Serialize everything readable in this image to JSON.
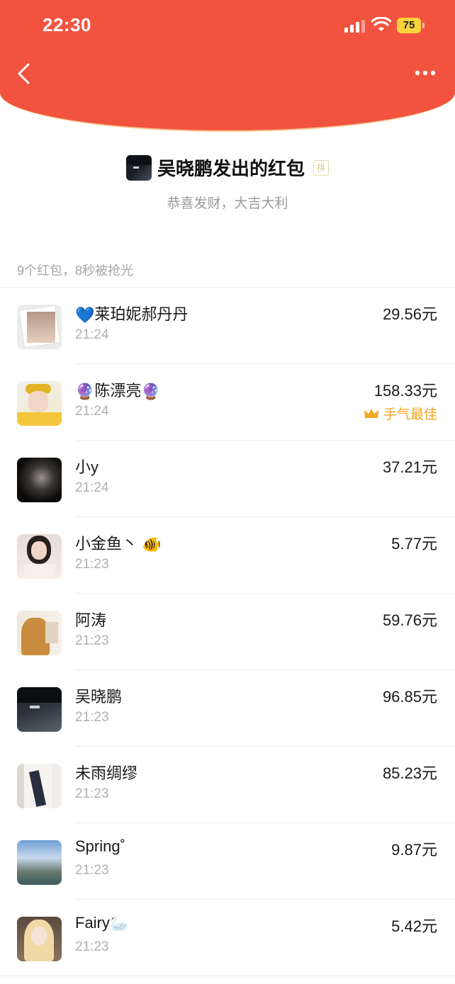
{
  "status_bar": {
    "time": "22:30",
    "battery": "75"
  },
  "owner": {
    "title": "吴晓鹏发出的红包",
    "pin_label": "拼",
    "blessing": "恭喜发财，大吉大利"
  },
  "summary": "9个红包，8秒被抢光",
  "best_label": "手气最佳",
  "colors": {
    "header": "#f1533f",
    "best": "#f2a623",
    "muted": "#b0b0b0"
  },
  "recipients": [
    {
      "prefix": "💙",
      "name": "莱珀妮郝丹丹",
      "suffix": "",
      "time": "21:24",
      "amount": "29.56元",
      "best": false
    },
    {
      "prefix": "🔮",
      "name": "陈漂亮",
      "suffix": "🔮",
      "time": "21:24",
      "amount": "158.33元",
      "best": true
    },
    {
      "prefix": "",
      "name": "小y",
      "suffix": "",
      "time": "21:24",
      "amount": "37.21元",
      "best": false
    },
    {
      "prefix": "",
      "name": "小金鱼丶",
      "suffix": "🐠",
      "time": "21:23",
      "amount": "5.77元",
      "best": false
    },
    {
      "prefix": "",
      "name": "阿涛",
      "suffix": "",
      "time": "21:23",
      "amount": "59.76元",
      "best": false
    },
    {
      "prefix": "",
      "name": "吴晓鹏",
      "suffix": "",
      "time": "21:23",
      "amount": "96.85元",
      "best": false
    },
    {
      "prefix": "",
      "name": "未雨绸缪",
      "suffix": "",
      "time": "21:23",
      "amount": "85.23元",
      "best": false
    },
    {
      "prefix": "",
      "name": "Spring˚",
      "suffix": "",
      "time": "21:23",
      "amount": "9.87元",
      "best": false
    },
    {
      "prefix": "",
      "name": "Fairy",
      "suffix": "🦢",
      "time": "21:23",
      "amount": "5.42元",
      "best": false
    }
  ]
}
